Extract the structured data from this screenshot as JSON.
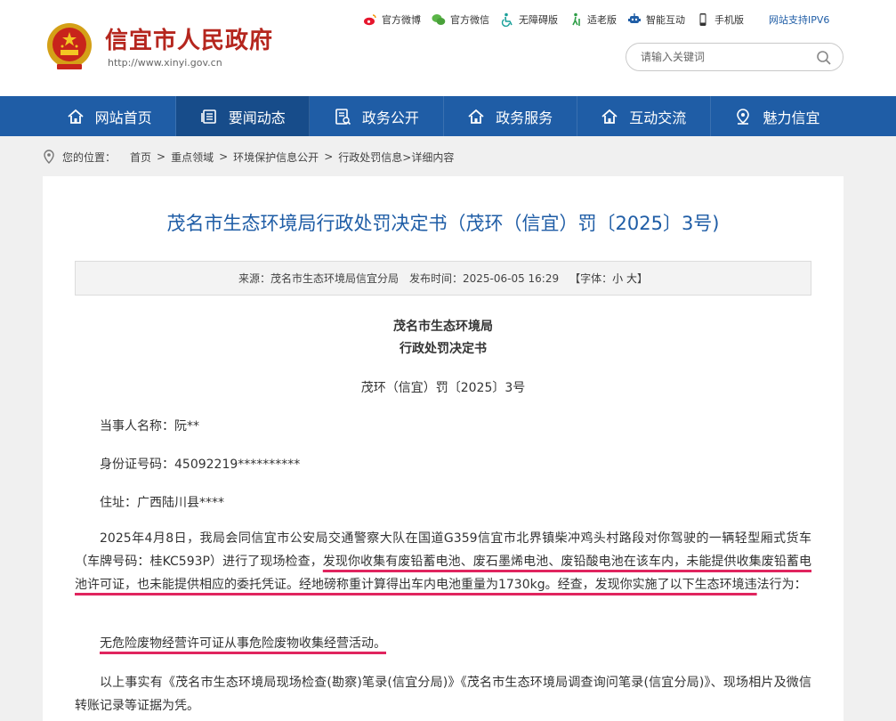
{
  "header": {
    "site_title": "信宜市人民政府",
    "site_url": "http://www.xinyi.gov.cn",
    "quick_links": [
      "官方微博",
      "官方微信",
      "无障碍版",
      "适老版",
      "智能互动",
      "手机版"
    ],
    "ipv6_text": "网站支持IPV6",
    "search_placeholder": "请输入关键词"
  },
  "nav": {
    "items": [
      "网站首页",
      "要闻动态",
      "政务公开",
      "政务服务",
      "互动交流",
      "魅力信宜"
    ],
    "active_index": 1
  },
  "breadcrumb": {
    "prefix": "您的位置：",
    "items": [
      "首页",
      "重点领域",
      "环境保护信息公开",
      "行政处罚信息"
    ],
    "tail": ">详细内容"
  },
  "article": {
    "title": "茂名市生态环境局行政处罚决定书（茂环（信宜）罚〔2025〕3号)",
    "meta": {
      "source": "来源：茂名市生态环境局信宜分局",
      "time": "发布时间：2025-06-05 16:29",
      "font_label": "【字体：",
      "font_small": "小",
      "font_large": "大",
      "font_close": "】"
    },
    "org_name": "茂名市生态环境局",
    "doc_type": "行政处罚决定书",
    "doc_number": "茂环（信宜）罚〔2025〕3号",
    "party_name": "当事人名称：阮**",
    "id_number": "身份证号码：45092219**********",
    "address": "住址：广西陆川县****",
    "para1_a": "2025年4月8日，我局会同信宜市公安局交通警察大队在国道G359信宜市北界镇柴冲鸡头村路段对你驾驶的一辆轻型厢式货车（车牌号码：桂KC593P）进行了现场检查，",
    "para1_b": "发现你收集有废铅蓄电池、废石墨烯电池、废铅酸电池在该车内，未能提供收集废铅蓄电池许可证，也未能提供相应的委托凭证。经地磅称重计算得出车内电池重量为1730kg。经查，发现你实施了以下生态环境违",
    "para1_c": "法行为：",
    "violation": "无危险废物经营许可证从事危险废物收集经营活动。",
    "para2": "以上事实有《茂名市生态环境局现场检查(勘察)笔录(信宜分局)》《茂名市生态环境局调查询问笔录(信宜分局)》、现场相片及微信转账记录等证据为凭。"
  },
  "colors": {
    "brand_red": "#b5261e",
    "nav_blue": "#1f5da6",
    "nav_active": "#174c8a",
    "title_blue": "#1f5da6",
    "highlight_underline": "#e0245e"
  }
}
